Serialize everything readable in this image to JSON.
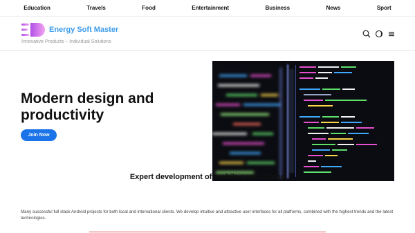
{
  "topnav": {
    "items": [
      "Education",
      "Travels",
      "Food",
      "Entertainment",
      "Business",
      "News",
      "Sport"
    ]
  },
  "header": {
    "brand": "Energy Soft Master",
    "tagline": "Innovative Products – Individual Solutions",
    "icons": [
      "search-icon",
      "dark-mode-icon",
      "menu-icon"
    ]
  },
  "hero": {
    "title": "Modern design and productivity",
    "button_label": "Join Now",
    "image_icon": "code-screen-image"
  },
  "section": {
    "title": "Expert development of mobile applications",
    "body": "Many successful full stack Android projects for both local and international clients. We develop intuitive and attractive user interfaces for all platforms, combined with the highest trends and the latest technologies."
  },
  "colors": {
    "brand": "#3d9be9",
    "logo_gradient_start": "#b14fe6",
    "logo_gradient_end": "#f2a3f0",
    "button": "#1a73e8",
    "divider": "#d9534f"
  }
}
